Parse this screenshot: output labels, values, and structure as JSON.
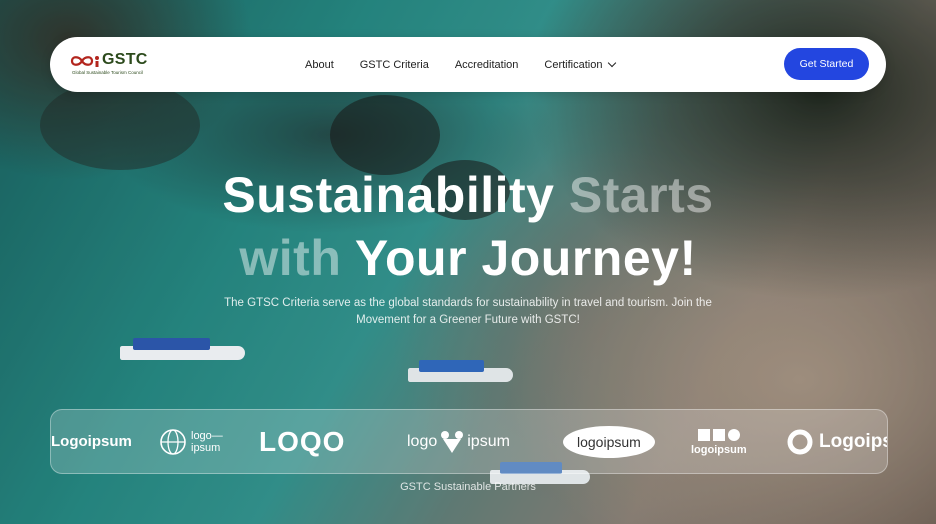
{
  "brand": {
    "name": "GSTC",
    "tagline": "Global Sustainable Tourism Council"
  },
  "nav": {
    "items": [
      {
        "label": "About"
      },
      {
        "label": "GSTC Criteria"
      },
      {
        "label": "Accreditation"
      },
      {
        "label": "Certification"
      }
    ],
    "cta_label": "Get Started"
  },
  "hero": {
    "line1_bright": "Sustainability",
    "line1_dim": "Starts",
    "line2_dim": "with",
    "line2_bright": "Your Journey!",
    "subtitle": "The GTSC Criteria serve as the global standards for sustainability in travel and tourism. Join the Movement for a Greener Future with GSTC!"
  },
  "partners": {
    "logos": [
      {
        "text": "Logoipsum"
      },
      {
        "text": "logo—",
        "text2": "ipsum"
      },
      {
        "text": "LOQO"
      },
      {
        "text": "logo",
        "text2": "ipsum"
      },
      {
        "text": "logoipsum"
      },
      {
        "text": "logoipsum"
      },
      {
        "text": "Logoips"
      }
    ],
    "caption": "GSTC Sustainable Partners"
  },
  "colors": {
    "accent": "#2346e0",
    "brand_green": "#2c4a1c",
    "brand_red": "#b3261e"
  }
}
